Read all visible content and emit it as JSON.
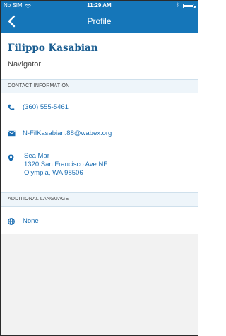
{
  "status_bar": {
    "carrier": "No SIM",
    "time": "11:29 AM"
  },
  "nav": {
    "title": "Profile",
    "back_icon": "chevron-left-icon"
  },
  "profile": {
    "name": "Filippo Kasabian",
    "role": "Navigator"
  },
  "contact": {
    "header": "CONTACT INFORMATION",
    "phone": "(360) 555-5461",
    "email": "N-FilKasabian.88@wabex.org",
    "address_line1": "Sea Mar",
    "address_line2": "1320 San Francisco Ave NE",
    "address_line3": "Olympia, WA 98506"
  },
  "language": {
    "header": "ADDITIONAL LANGUAGE",
    "value": "None"
  },
  "colors": {
    "accent": "#1576b9",
    "name_text": "#1a5d91",
    "link_text": "#1a6db2",
    "section_bg": "#eef5fa"
  }
}
